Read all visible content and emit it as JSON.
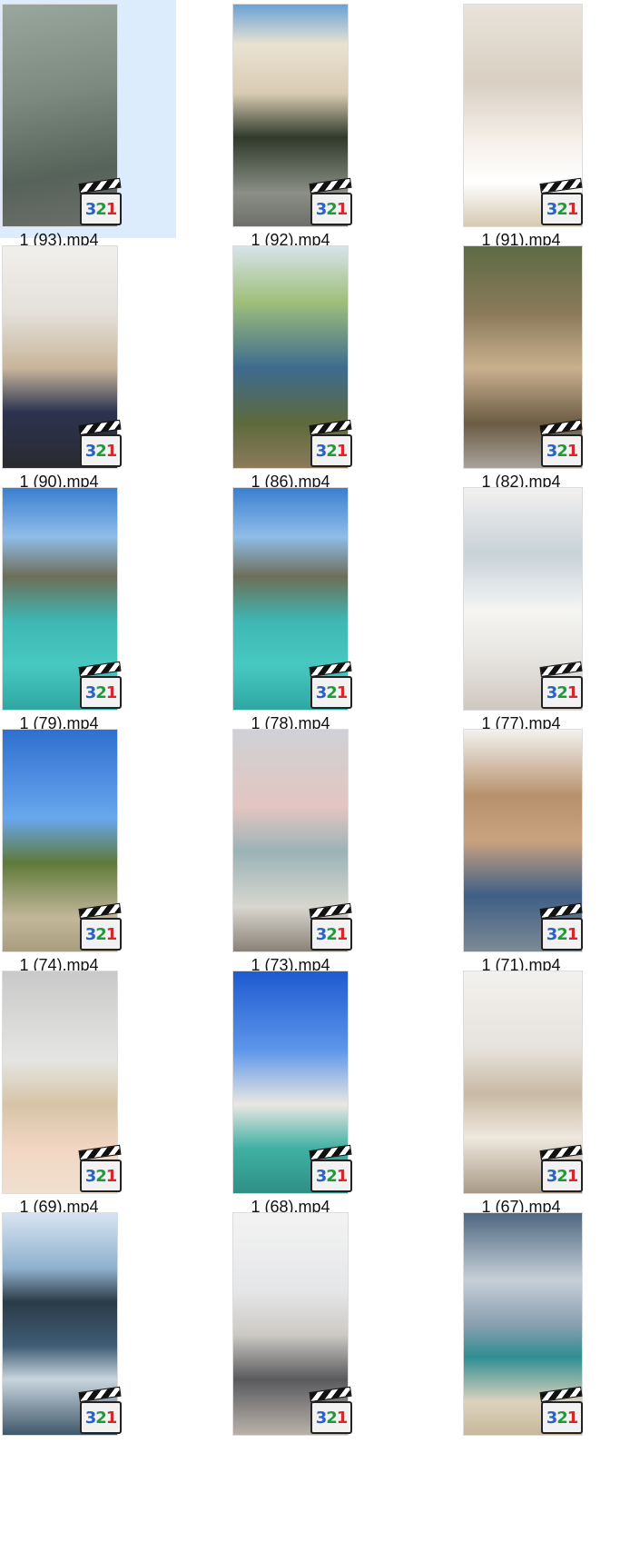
{
  "icons": {
    "video_badge": "media-player-321-icon"
  },
  "badge_digits": [
    "3",
    "2",
    "1"
  ],
  "files": [
    {
      "name": "1 (93).mp4",
      "selected": true,
      "scene": "water-text"
    },
    {
      "name": "1 (92).mp4",
      "selected": false,
      "scene": "bicycle"
    },
    {
      "name": "1 (91).mp4",
      "selected": false,
      "scene": "room-bottle"
    },
    {
      "name": "1 (90).mp4",
      "selected": false,
      "scene": "unpacking"
    },
    {
      "name": "1 (86).mp4",
      "selected": false,
      "scene": "sunflowers-garden"
    },
    {
      "name": "1 (82).mp4",
      "selected": false,
      "scene": "forest-path"
    },
    {
      "name": "1 (79).mp4",
      "selected": false,
      "scene": "bay-boat"
    },
    {
      "name": "1 (78).mp4",
      "selected": false,
      "scene": "bay-boat"
    },
    {
      "name": "1 (77).mp4",
      "selected": false,
      "scene": "bathtub"
    },
    {
      "name": "1 (74).mp4",
      "selected": false,
      "scene": "coast-walk"
    },
    {
      "name": "1 (73).mp4",
      "selected": false,
      "scene": "beach-tree"
    },
    {
      "name": "1 (71).mp4",
      "selected": false,
      "scene": "sunflowers-hand"
    },
    {
      "name": "1 (69).mp4",
      "selected": false,
      "scene": "bed"
    },
    {
      "name": "1 (68).mp4",
      "selected": false,
      "scene": "selfie-sky"
    },
    {
      "name": "1 (67).mp4",
      "selected": false,
      "scene": "living-room"
    },
    {
      "name": "",
      "selected": false,
      "scene": "sparkling-water"
    },
    {
      "name": "",
      "selected": false,
      "scene": "clinic"
    },
    {
      "name": "",
      "selected": false,
      "scene": "cloudy-beach"
    }
  ]
}
